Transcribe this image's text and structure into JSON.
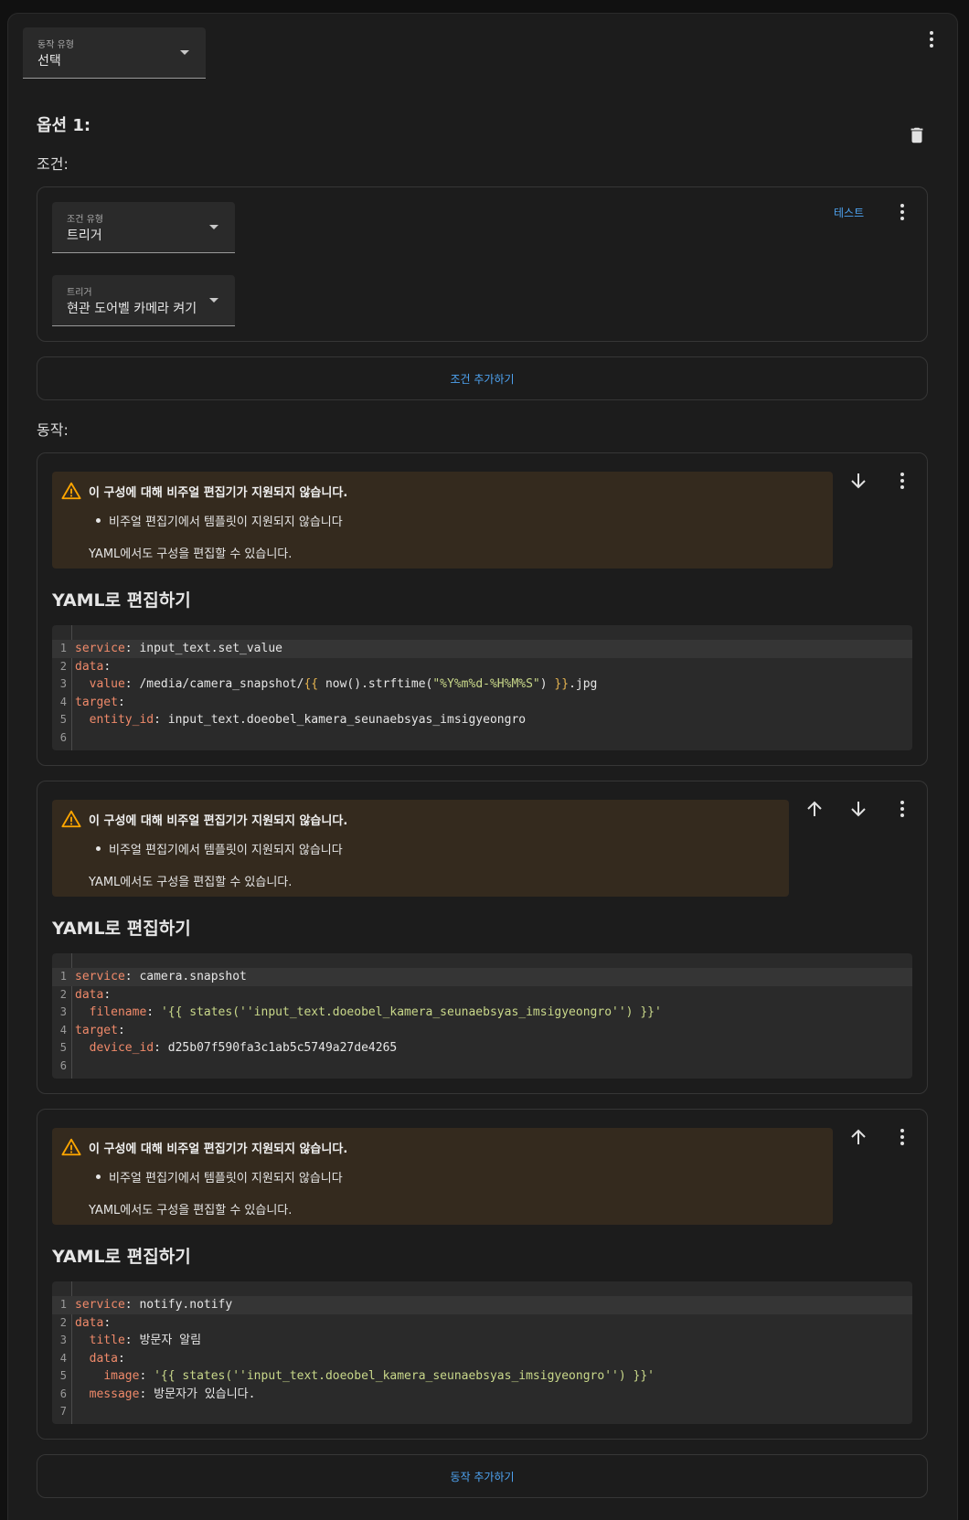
{
  "action_type_select": {
    "label": "동작 유형",
    "value": "선택"
  },
  "option": {
    "title": "옵션 1:",
    "conditions_label": "조건:",
    "condition": {
      "type_select": {
        "label": "조건 유형",
        "value": "트리거"
      },
      "trigger_select": {
        "label": "트리거",
        "value": "현관 도어벨 카메라 켜기"
      },
      "test_label": "테스트"
    },
    "add_condition_label": "조건 추가하기",
    "actions_label": "동작:",
    "add_action_label": "동작 추가하기"
  },
  "actions": [
    {
      "alert": {
        "title": "이 구성에 대해 비주얼 편집기가 지원되지 않습니다.",
        "bullet": "비주얼 편집기에서 템플릿이 지원되지 않습니다",
        "note": "YAML에서도 구성을 편집할 수 있습니다."
      },
      "yaml_heading": "YAML로 편집하기",
      "code": [
        [
          "1",
          [
            [
              "k",
              "service"
            ],
            [
              "t",
              ": input_text.set_value"
            ]
          ]
        ],
        [
          "2",
          [
            [
              "k",
              "data"
            ],
            [
              "t",
              ":"
            ]
          ]
        ],
        [
          "3",
          [
            [
              "t",
              "  "
            ],
            [
              "k",
              "value"
            ],
            [
              "t",
              ": /media/camera_snapshot/"
            ],
            [
              "p",
              "{{"
            ],
            [
              "t",
              " now().strftime("
            ],
            [
              "s",
              "\"%Y%m%d-%H%M%S\""
            ],
            [
              "t",
              ") "
            ],
            [
              "p",
              "}}"
            ],
            [
              "t",
              ".jpg"
            ]
          ]
        ],
        [
          "4",
          [
            [
              "k",
              "target"
            ],
            [
              "t",
              ":"
            ]
          ]
        ],
        [
          "5",
          [
            [
              "t",
              "  "
            ],
            [
              "k",
              "entity_id"
            ],
            [
              "t",
              ": input_text.doeobel_kamera_seunaebsyas_imsigyeongro"
            ]
          ]
        ],
        [
          "6",
          []
        ]
      ]
    },
    {
      "alert": {
        "title": "이 구성에 대해 비주얼 편집기가 지원되지 않습니다.",
        "bullet": "비주얼 편집기에서 템플릿이 지원되지 않습니다",
        "note": "YAML에서도 구성을 편집할 수 있습니다."
      },
      "yaml_heading": "YAML로 편집하기",
      "code": [
        [
          "1",
          [
            [
              "k",
              "service"
            ],
            [
              "t",
              ": camera.snapshot"
            ]
          ]
        ],
        [
          "2",
          [
            [
              "k",
              "data"
            ],
            [
              "t",
              ":"
            ]
          ]
        ],
        [
          "3",
          [
            [
              "t",
              "  "
            ],
            [
              "k",
              "filename"
            ],
            [
              "t",
              ": "
            ],
            [
              "s",
              "'{{ states(''input_text.doeobel_kamera_seunaebsyas_imsigyeongro'') }}'"
            ]
          ]
        ],
        [
          "4",
          [
            [
              "k",
              "target"
            ],
            [
              "t",
              ":"
            ]
          ]
        ],
        [
          "5",
          [
            [
              "t",
              "  "
            ],
            [
              "k",
              "device_id"
            ],
            [
              "t",
              ": d25b07f590fa3c1ab5c5749a27de4265"
            ]
          ]
        ],
        [
          "6",
          []
        ]
      ]
    },
    {
      "alert": {
        "title": "이 구성에 대해 비주얼 편집기가 지원되지 않습니다.",
        "bullet": "비주얼 편집기에서 템플릿이 지원되지 않습니다",
        "note": "YAML에서도 구성을 편집할 수 있습니다."
      },
      "yaml_heading": "YAML로 편집하기",
      "code": [
        [
          "1",
          [
            [
              "k",
              "service"
            ],
            [
              "t",
              ": notify.notify"
            ]
          ]
        ],
        [
          "2",
          [
            [
              "k",
              "data"
            ],
            [
              "t",
              ":"
            ]
          ]
        ],
        [
          "3",
          [
            [
              "t",
              "  "
            ],
            [
              "k",
              "title"
            ],
            [
              "t",
              ": 방문자 알림"
            ]
          ]
        ],
        [
          "4",
          [
            [
              "t",
              "  "
            ],
            [
              "k",
              "data"
            ],
            [
              "t",
              ":"
            ]
          ]
        ],
        [
          "5",
          [
            [
              "t",
              "    "
            ],
            [
              "k",
              "image"
            ],
            [
              "t",
              ": "
            ],
            [
              "s",
              "'{{ states(''input_text.doeobel_kamera_seunaebsyas_imsigyeongro'') }}'"
            ]
          ]
        ],
        [
          "6",
          [
            [
              "t",
              "  "
            ],
            [
              "k",
              "message"
            ],
            [
              "t",
              ": 방문자가 있습니다."
            ]
          ]
        ],
        [
          "7",
          []
        ]
      ]
    }
  ],
  "icons": {
    "more": "more-vert-icon",
    "delete": "trash-icon",
    "warning": "warning-triangle-icon",
    "up": "arrow-up-icon",
    "down": "arrow-down-icon"
  },
  "colors": {
    "accent": "#4ea3f1",
    "warning": "#ffa600",
    "alert_bg": "#342a1e"
  }
}
